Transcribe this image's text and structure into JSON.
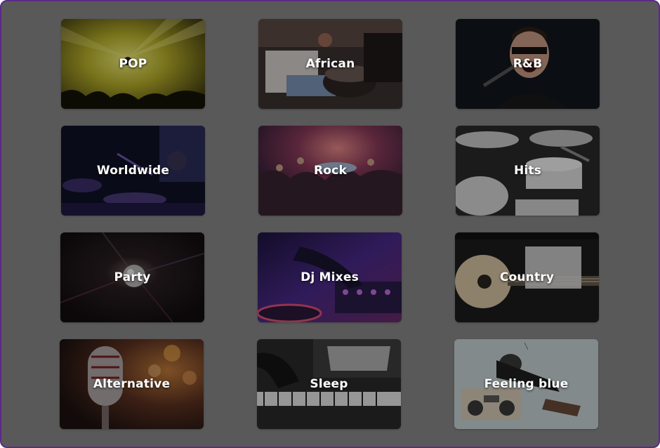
{
  "genres": [
    {
      "id": "pop",
      "label": "POP"
    },
    {
      "id": "african",
      "label": "African"
    },
    {
      "id": "rnb",
      "label": "R&B"
    },
    {
      "id": "worldwide",
      "label": "Worldwide"
    },
    {
      "id": "rock",
      "label": "Rock"
    },
    {
      "id": "hits",
      "label": "Hits"
    },
    {
      "id": "party",
      "label": "Party"
    },
    {
      "id": "dj-mixes",
      "label": "Dj Mixes"
    },
    {
      "id": "country",
      "label": "Country"
    },
    {
      "id": "alternative",
      "label": "Alternative"
    },
    {
      "id": "sleep",
      "label": "Sleep"
    },
    {
      "id": "feeling-blue",
      "label": "Feeling blue"
    }
  ],
  "colors": {
    "frame_border": "#5b2a86",
    "backdrop": "#595959",
    "label_text": "#ffffff"
  }
}
